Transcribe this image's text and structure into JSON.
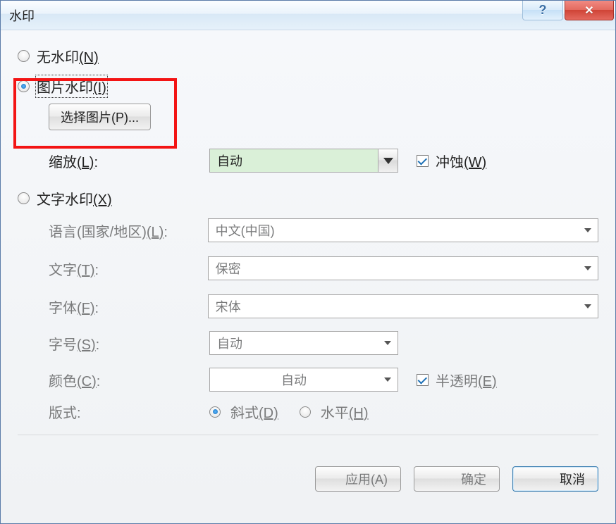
{
  "titlebar": {
    "title": "水印",
    "help_glyph": "?",
    "close_glyph": "✕"
  },
  "radios": {
    "no_watermark": {
      "label": "无水印",
      "accel": "(N)"
    },
    "picture_watermark": {
      "label": "图片水印",
      "accel": "(I)"
    },
    "text_watermark": {
      "label": "文字水印",
      "accel": "(X)"
    }
  },
  "picture": {
    "select_button": "选择图片(P)...",
    "scale_label": "缩放",
    "scale_accel": "(L)",
    "scale_value": "自动",
    "washout_label": "冲蚀",
    "washout_accel": "(W)"
  },
  "text": {
    "language_label": "语言(国家/地区)",
    "language_accel": "(L)",
    "language_value": "中文(中国)",
    "text_label": "文字",
    "text_accel": "(T)",
    "text_value": "保密",
    "font_label": "字体",
    "font_accel": "(F)",
    "font_value": "宋体",
    "size_label": "字号",
    "size_accel": "(S)",
    "size_value": "自动",
    "color_label": "颜色",
    "color_accel": "(C)",
    "color_value": "自动",
    "semitransparent_label": "半透明",
    "semitransparent_accel": "(E)",
    "layout_label": "版式",
    "diagonal_label": "斜式",
    "diagonal_accel": "(D)",
    "horizontal_label": "水平",
    "horizontal_accel": "(H)"
  },
  "footer": {
    "apply": "应用(A)",
    "ok": "确定",
    "cancel": "取消"
  }
}
